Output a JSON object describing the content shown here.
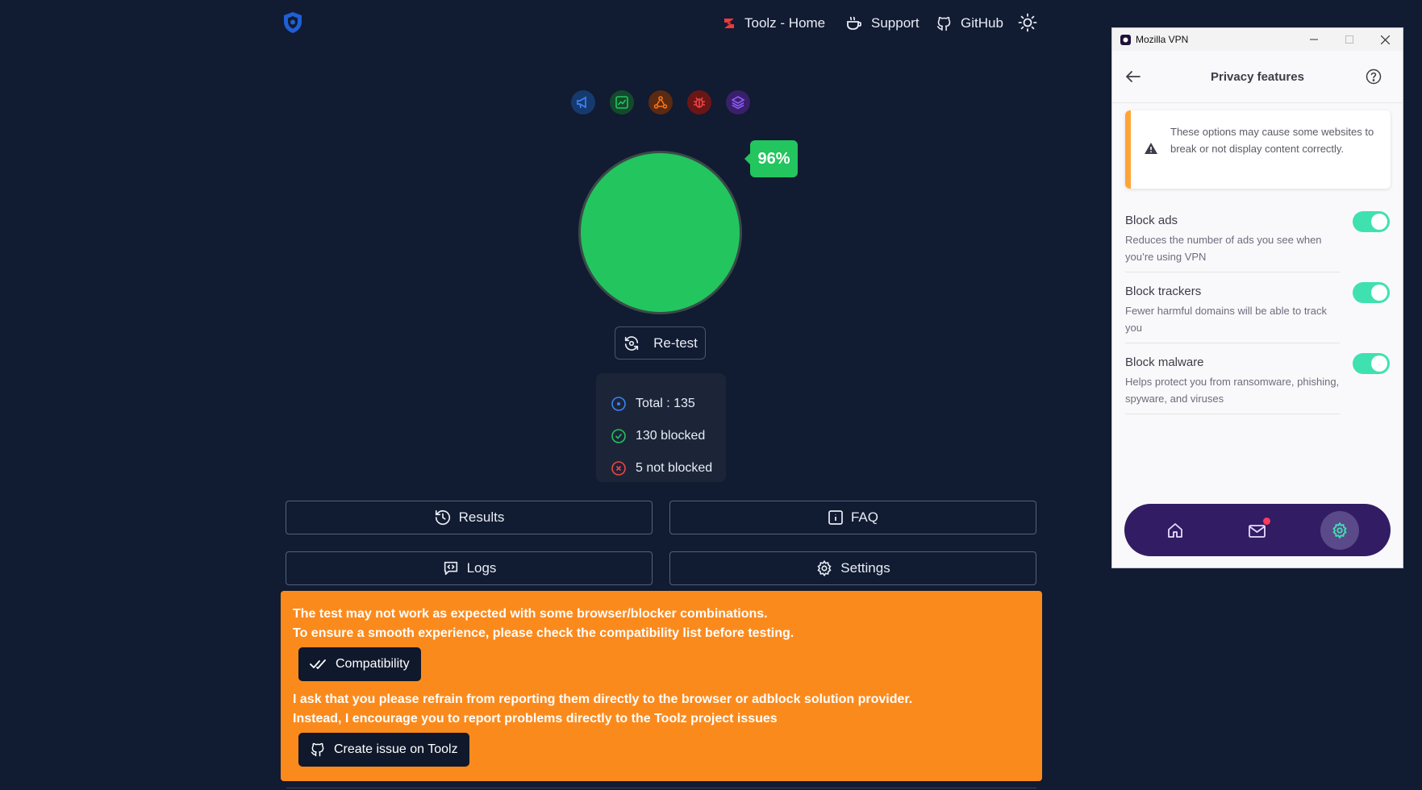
{
  "nav": {
    "home_label": "Toolz - Home",
    "support_label": "Support",
    "github_label": "GitHub"
  },
  "categories": [
    "ads-icon",
    "analytics-icon",
    "error-trackers-icon",
    "malware-icon",
    "mix-icon"
  ],
  "score": {
    "percent_label": "96%",
    "percent": 96
  },
  "retest_label": "Re-test",
  "stats": {
    "total": "Total : 135",
    "blocked": "130 blocked",
    "not_blocked": "5 not blocked"
  },
  "buttons": {
    "results": "Results",
    "faq": "FAQ",
    "logs": "Logs",
    "settings": "Settings"
  },
  "notice": {
    "line1": "The test may not work as expected with some browser/blocker combinations.",
    "line2": "To ensure a smooth experience, please check the compatibility list before testing.",
    "compat_label": "Compatibility",
    "line3": "I ask that you please refrain from reporting them directly to the browser or adblock solution provider.",
    "line4": "Instead, I encourage you to report problems directly to the Toolz project issues",
    "issue_label": "Create issue on Toolz"
  },
  "vpn": {
    "window_title": "Mozilla VPN",
    "header": "Privacy features",
    "warning": "These options may cause some websites to break or not display content correctly.",
    "features": [
      {
        "title": "Block ads",
        "desc": "Reduces the number of ads you see when you’re using VPN",
        "enabled": true
      },
      {
        "title": "Block trackers",
        "desc": "Fewer harmful domains will be able to track you",
        "enabled": true
      },
      {
        "title": "Block malware",
        "desc": "Helps protect you from ransomware, phishing, spyware, and viruses",
        "enabled": true
      }
    ]
  },
  "colors": {
    "background": "#111b31",
    "success": "#22c55e",
    "notice": "#fb8a1d",
    "vpn_nav": "#321c64",
    "toggle_on": "#3fe1b0"
  }
}
